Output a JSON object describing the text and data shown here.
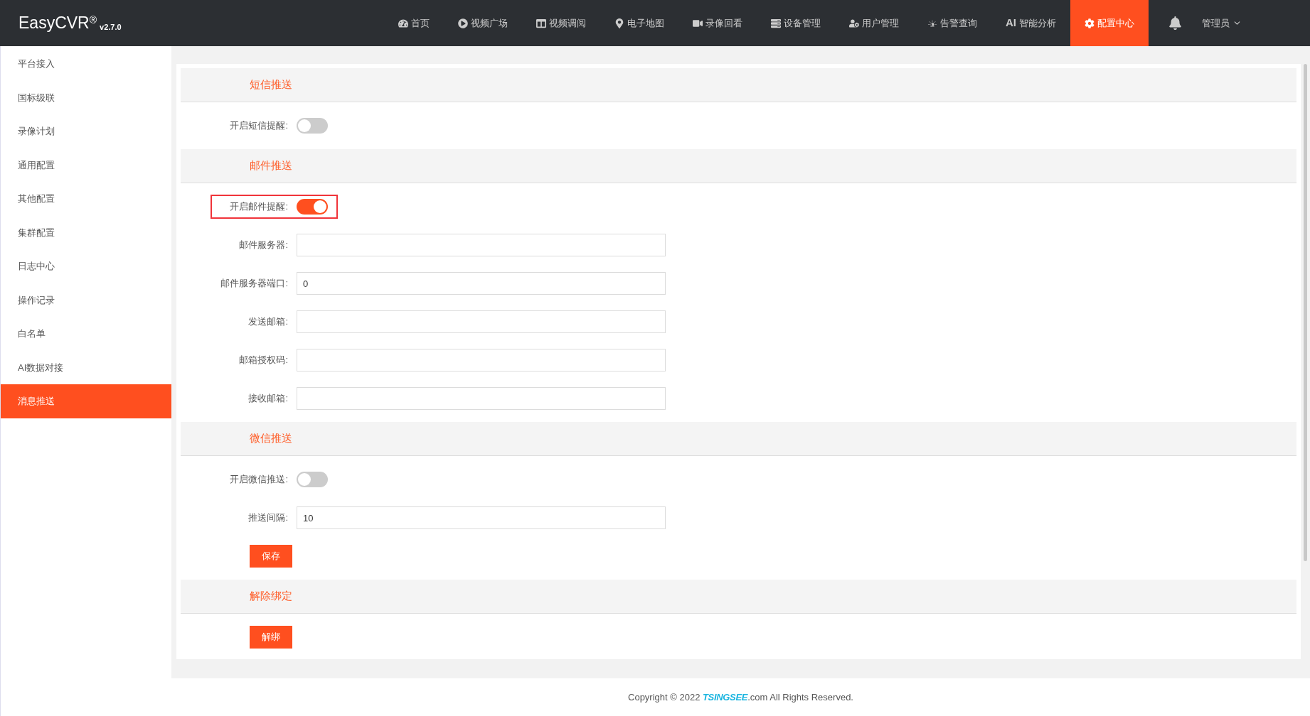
{
  "brand": {
    "name": "EasyCVR",
    "mark": "®",
    "version": "v2.7.0"
  },
  "nav": [
    {
      "label": "首页",
      "selected": false
    },
    {
      "label": "视频广场",
      "selected": false
    },
    {
      "label": "视频调阅",
      "selected": false
    },
    {
      "label": "电子地图",
      "selected": false
    },
    {
      "label": "录像回看",
      "selected": false
    },
    {
      "label": "设备管理",
      "selected": false
    },
    {
      "label": "用户管理",
      "selected": false
    },
    {
      "label": "告警查询",
      "selected": false
    },
    {
      "label": "智能分析",
      "badge": "AI",
      "selected": false
    },
    {
      "label": "配置中心",
      "selected": true
    }
  ],
  "user": {
    "label": "管理员"
  },
  "sidebar": {
    "items": [
      {
        "label": "平台接入",
        "selected": false
      },
      {
        "label": "国标级联",
        "selected": false
      },
      {
        "label": "录像计划",
        "selected": false
      },
      {
        "label": "通用配置",
        "selected": false
      },
      {
        "label": "其他配置",
        "selected": false
      },
      {
        "label": "集群配置",
        "selected": false
      },
      {
        "label": "日志中心",
        "selected": false
      },
      {
        "label": "操作记录",
        "selected": false
      },
      {
        "label": "白名单",
        "selected": false
      },
      {
        "label": "AI数据对接",
        "selected": false
      },
      {
        "label": "消息推送",
        "selected": true
      }
    ]
  },
  "sections": [
    {
      "title": "短信推送",
      "rows": [
        {
          "kind": "toggle",
          "label": "开启短信提醒:",
          "on": false,
          "highlighted": false
        }
      ]
    },
    {
      "title": "邮件推送",
      "rows": [
        {
          "kind": "toggle",
          "label": "开启邮件提醒:",
          "on": true,
          "highlighted": true
        },
        {
          "kind": "input",
          "label": "邮件服务器:"
        },
        {
          "kind": "input",
          "label": "邮件服务器端口:",
          "value": "0"
        },
        {
          "kind": "input",
          "label": "发送邮箱:"
        },
        {
          "kind": "input",
          "label": "邮箱授权码:"
        },
        {
          "kind": "input",
          "label": "接收邮箱:"
        }
      ]
    },
    {
      "title": "微信推送",
      "rows": [
        {
          "kind": "toggle",
          "label": "开启微信推送:",
          "on": false,
          "highlighted": false
        },
        {
          "kind": "input",
          "label": "推送间隔:",
          "value": "10"
        },
        {
          "kind": "button",
          "label": "保存"
        }
      ]
    },
    {
      "title": "解除绑定",
      "rows": [
        {
          "kind": "button",
          "label": "解绑"
        }
      ]
    }
  ],
  "footer": {
    "prefix": "Copyright © 2022",
    "logo": "TSINGSEE",
    "suffix": ".com All Rights Reserved."
  }
}
